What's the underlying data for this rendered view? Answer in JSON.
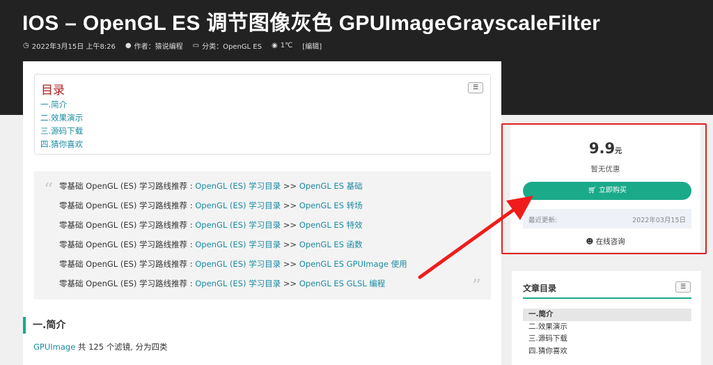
{
  "post": {
    "title": "IOS – OpenGL ES 调节图像灰色 GPUImageGrayscaleFilter",
    "date": "2022年3月15日 上午8:26",
    "author": "作者：猿说编程",
    "category": "分类：OpenGL ES",
    "temperature": "1℃",
    "edit": "[编辑]"
  },
  "toc": {
    "title": "目录",
    "toggle_icon": "list-toggle-icon",
    "items": [
      "一.简介",
      "二.效果演示",
      "三.源码下载",
      "四.猜你喜欢"
    ]
  },
  "quote": {
    "prefix": "零基础 OpenGL (ES) 学习路线推荐 : ",
    "link1": "OpenGL (ES) 学习目录",
    "sep": " >> ",
    "lines": [
      "OpenGL ES 基础",
      "OpenGL ES 转场",
      "OpenGL ES 特效",
      "OpenGL ES 函数",
      "OpenGL ES GPUImage 使用",
      "OpenGL ES GLSL 编程"
    ]
  },
  "section": {
    "heading": "一.简介",
    "para_link": "GPUImage",
    "para_text": " 共 125 个滤镜, 分为四类"
  },
  "buy": {
    "price": "9.9",
    "unit": "元",
    "promo": "暂无优惠",
    "button": "立即购买",
    "update_label": "最近更新:",
    "update_value": "2022年03月15日",
    "consult": "在线咨询",
    "outline_color": "#e02020",
    "accent_color": "#1aaa8a"
  },
  "side_toc": {
    "title": "文章目录",
    "items": [
      "一.简介",
      "二.效果演示",
      "三.源码下载",
      "四.猜你喜欢"
    ]
  }
}
